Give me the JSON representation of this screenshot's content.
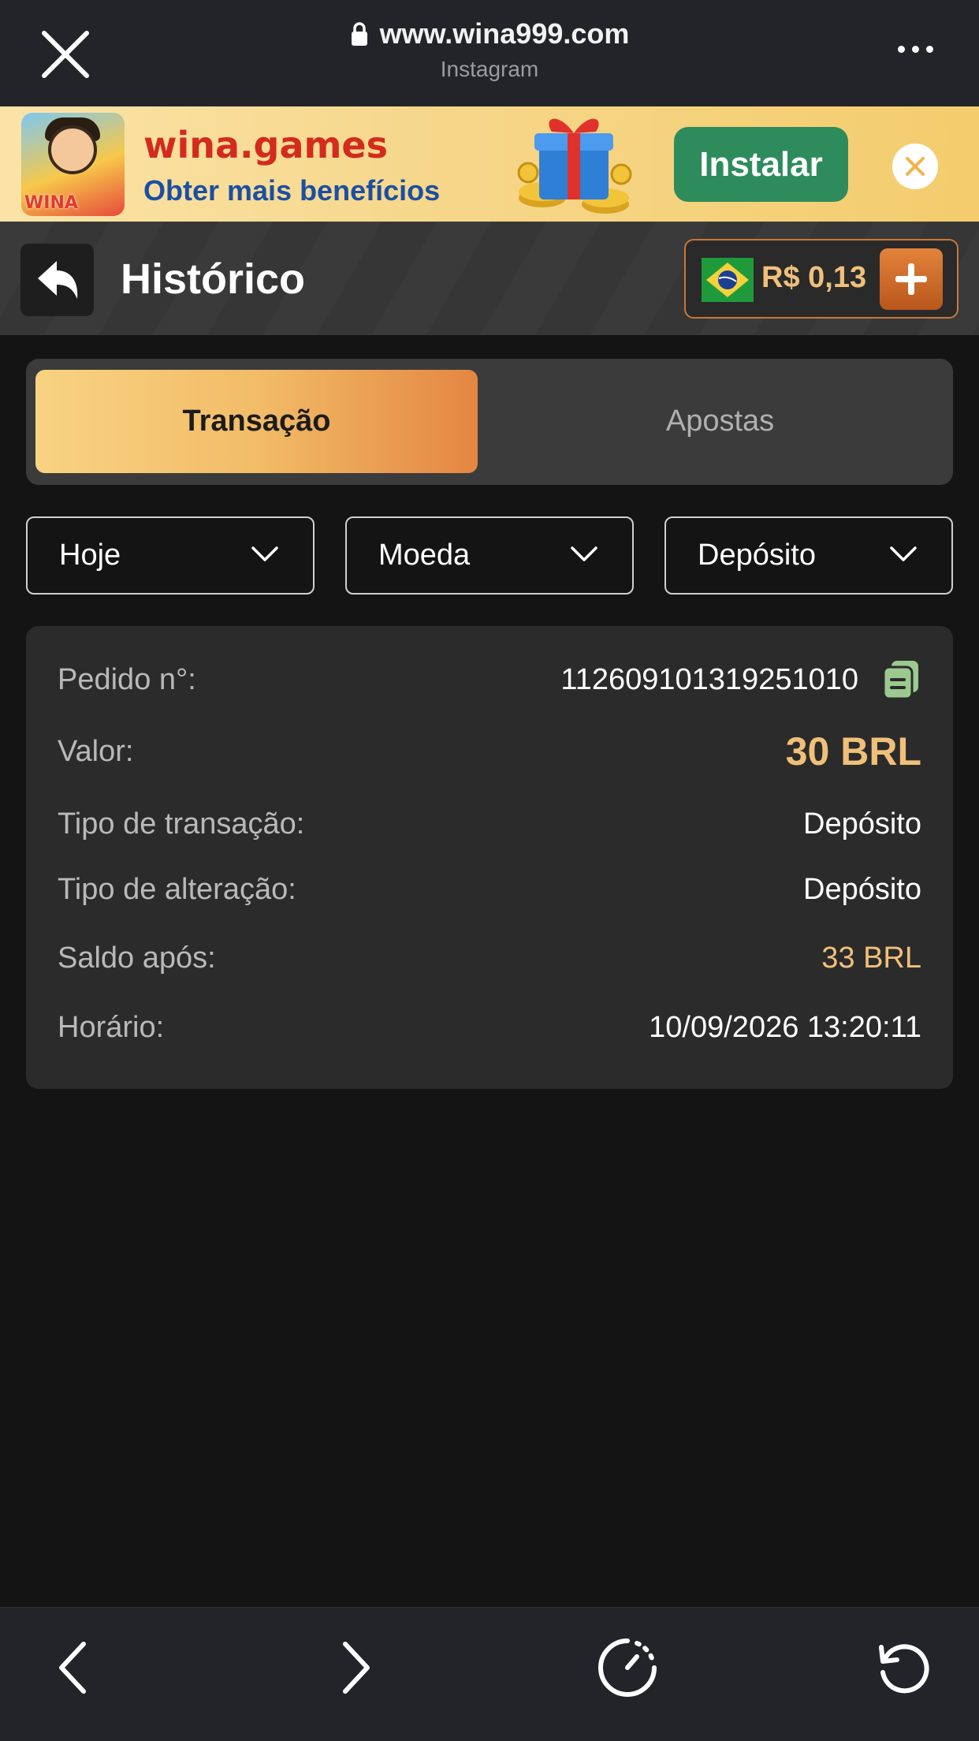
{
  "browser": {
    "url": "www.wina999.com",
    "source": "Instagram"
  },
  "banner": {
    "logo_text": "WINA",
    "title": "wina.games",
    "subtitle": "Obter mais benefícios",
    "install_label": "Instalar"
  },
  "header": {
    "title": "Histórico",
    "balance": "R$ 0,13"
  },
  "tabs": [
    {
      "label": "Transação",
      "active": true
    },
    {
      "label": "Apostas",
      "active": false
    }
  ],
  "filters": {
    "period": "Hoje",
    "currency": "Moeda",
    "type": "Depósito"
  },
  "transaction": {
    "order_label": "Pedido n°:",
    "order_value": "112609101319251010",
    "amount_label": "Valor:",
    "amount_value": "30 BRL",
    "tx_type_label": "Tipo de transação:",
    "tx_type_value": "Depósito",
    "change_type_label": "Tipo de alteração:",
    "change_type_value": "Depósito",
    "balance_after_label": "Saldo após:",
    "balance_after_value": "33 BRL",
    "time_label": "Horário:",
    "time_value": "10/09/2026 13:20:11"
  },
  "colors": {
    "accent_gold": "#f0c07a",
    "install_green": "#2e8c5c",
    "page_bg": "#151414",
    "card_bg": "#2b2b2b"
  },
  "icons": [
    "close-icon",
    "lock-icon",
    "more-icon",
    "banner-close-icon",
    "back-arrow-icon",
    "brazil-flag-icon",
    "plus-icon",
    "chevron-down-icon",
    "copy-icon",
    "back-icon",
    "forward-icon",
    "speed-icon",
    "reload-icon"
  ]
}
